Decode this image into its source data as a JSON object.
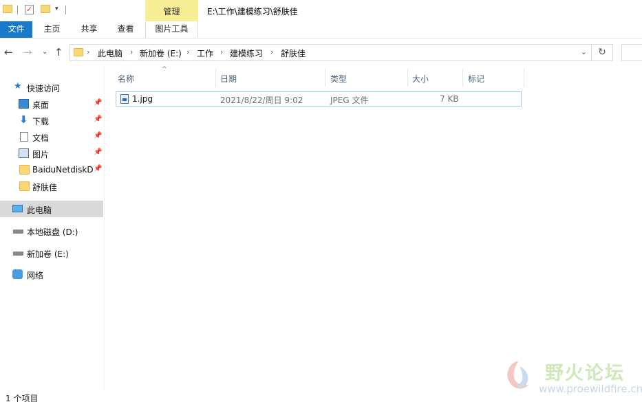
{
  "window": {
    "path_title": "E:\\工作\\建模练习\\舒肤佳",
    "context_tab_group": "管理"
  },
  "ribbon": {
    "tabs": [
      "文件",
      "主页",
      "共享",
      "查看",
      "图片工具"
    ]
  },
  "address": {
    "crumbs": [
      "此电脑",
      "新加卷 (E:)",
      "工作",
      "建模练习",
      "舒肤佳"
    ]
  },
  "navpane": {
    "quick_access": "快速访问",
    "pinned": [
      "桌面",
      "下载",
      "文档",
      "图片",
      "BaiduNetdiskD"
    ],
    "recent": [
      "舒肤佳"
    ],
    "this_pc": "此电脑",
    "drives": [
      "本地磁盘 (D:)",
      "新加卷 (E:)"
    ],
    "network": "网络"
  },
  "columns": {
    "name": "名称",
    "date": "日期",
    "type": "类型",
    "size": "大小",
    "tags": "标记"
  },
  "files": [
    {
      "name": "1.jpg",
      "date": "2021/8/22/周日 9:02",
      "type": "JPEG 文件",
      "size": "7 KB"
    }
  ],
  "status": {
    "count": "1 个项目"
  },
  "watermark": {
    "text": "野火论坛",
    "url": "www.proewildfire.cn"
  }
}
